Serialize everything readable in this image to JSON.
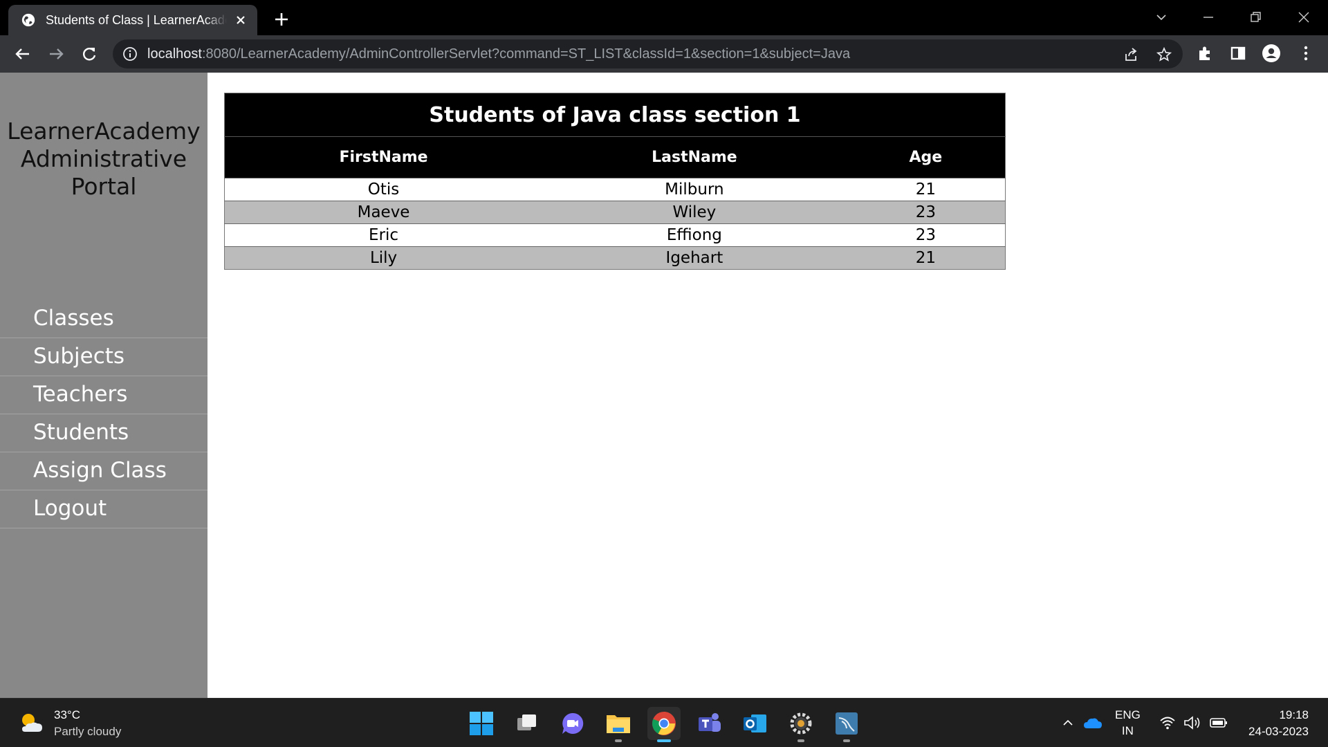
{
  "browser": {
    "tab_title": "Students of Class | LearnerAcademy",
    "url_host": "localhost",
    "url_rest": ":8080/LearnerAcademy/AdminControllerServlet?command=ST_LIST&classId=1&section=1&subject=Java"
  },
  "sidebar": {
    "brand_lines": [
      "LearnerAcademy",
      "Administrative",
      "Portal"
    ],
    "items": [
      {
        "label": "Classes"
      },
      {
        "label": "Subjects"
      },
      {
        "label": "Teachers"
      },
      {
        "label": "Students"
      },
      {
        "label": "Assign Class"
      },
      {
        "label": "Logout"
      }
    ]
  },
  "table": {
    "caption": "Students of Java class section 1",
    "columns": [
      "FirstName",
      "LastName",
      "Age"
    ],
    "rows": [
      [
        "Otis",
        "Milburn",
        "21"
      ],
      [
        "Maeve",
        "Wiley",
        "23"
      ],
      [
        "Eric",
        "Effiong",
        "23"
      ],
      [
        "Lily",
        "Igehart",
        "21"
      ]
    ]
  },
  "taskbar": {
    "weather_temp": "33°C",
    "weather_condition": "Partly cloudy",
    "lang_line1": "ENG",
    "lang_line2": "IN",
    "time": "19:18",
    "date": "24-03-2023",
    "apps": [
      "start",
      "task-view",
      "chat",
      "file-explorer",
      "chrome",
      "teams",
      "outlook",
      "settings-app",
      "mysql-workbench"
    ],
    "active_app": "chrome"
  },
  "colors": {
    "sidebar_bg": "#888888",
    "table_header_bg": "#000000",
    "row_alt_bg": "#bbbbbb"
  }
}
